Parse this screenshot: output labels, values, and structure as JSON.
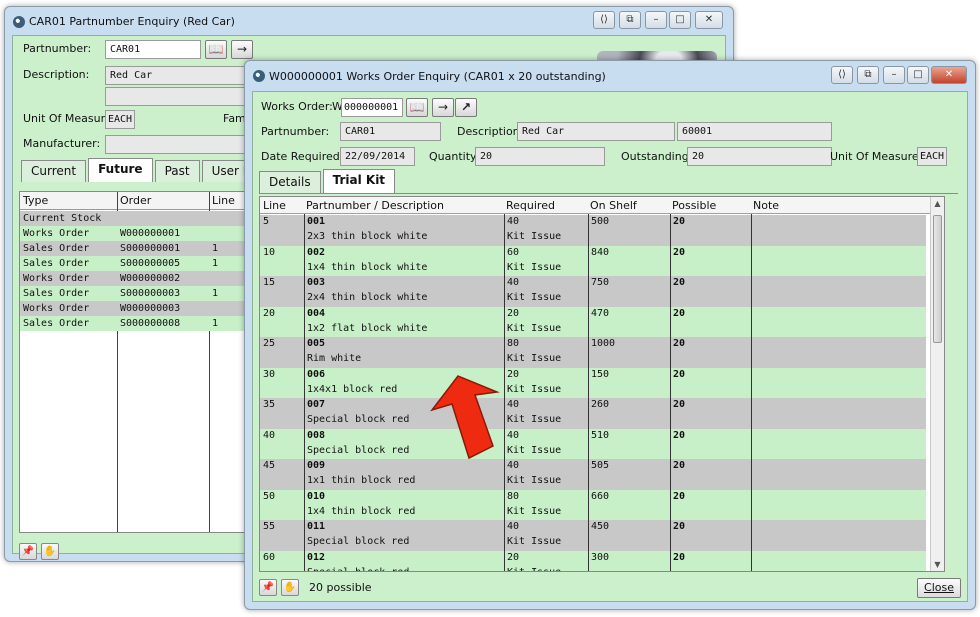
{
  "back_window": {
    "title": "CAR01 Partnumber Enquiry (Red Car)",
    "labels": {
      "partnumber": "Partnumber:",
      "description": "Description:",
      "unit_of_measure": "Unit Of Measure:",
      "family": "Famil",
      "manufacturer": "Manufacturer:"
    },
    "values": {
      "partnumber": "CAR01",
      "description": "Red Car",
      "unit_of_measure": "EACH"
    },
    "tabs": [
      "Current",
      "Future",
      "Past",
      "User Defined"
    ],
    "active_tab": "Future",
    "columns": [
      "Type",
      "Order",
      "Line"
    ],
    "rows": [
      {
        "type": "Current Stock",
        "order": "",
        "line": ""
      },
      {
        "type": "Works Order",
        "order": "W000000001",
        "line": ""
      },
      {
        "type": "Sales Order",
        "order": "S000000001",
        "line": "1"
      },
      {
        "type": "Sales Order",
        "order": "S000000005",
        "line": "1"
      },
      {
        "type": "Works Order",
        "order": "W000000002",
        "line": ""
      },
      {
        "type": "Sales Order",
        "order": "S000000003",
        "line": "1"
      },
      {
        "type": "Works Order",
        "order": "W000000003",
        "line": ""
      },
      {
        "type": "Sales Order",
        "order": "S000000008",
        "line": "1"
      }
    ]
  },
  "front_window": {
    "title": "W000000001 Works Order Enquiry (CAR01 x 20 outstanding)",
    "labels": {
      "works_order": "Works Order:",
      "partnumber": "Partnumber:",
      "description": "Description:",
      "date_required": "Date Required:",
      "quantity": "Quantity:",
      "outstanding": "Outstanding:",
      "unit_of_measure": "Unit Of Measure:"
    },
    "values": {
      "works_order_prefix": "W",
      "works_order": "000000001",
      "partnumber": "CAR01",
      "description": "Red Car",
      "extra_code": "60001",
      "date_required": "22/09/2014",
      "quantity": "20",
      "outstanding": "20",
      "unit_of_measure": "EACH"
    },
    "tabs": [
      "Details",
      "Trial Kit"
    ],
    "active_tab": "Trial Kit",
    "columns": [
      "Line",
      "Partnumber / Description",
      "Required",
      "On Shelf",
      "Possible",
      "Note"
    ],
    "rows": [
      {
        "line": "5",
        "part": "001",
        "desc": "2x3 thin block white",
        "required": "40",
        "issue": "Kit Issue",
        "on_shelf": "500",
        "possible": "20"
      },
      {
        "line": "10",
        "part": "002",
        "desc": "1x4 thin block white",
        "required": "60",
        "issue": "Kit Issue",
        "on_shelf": "840",
        "possible": "20"
      },
      {
        "line": "15",
        "part": "003",
        "desc": "2x4 thin block white",
        "required": "40",
        "issue": "Kit Issue",
        "on_shelf": "750",
        "possible": "20"
      },
      {
        "line": "20",
        "part": "004",
        "desc": "1x2 flat block white",
        "required": "20",
        "issue": "Kit Issue",
        "on_shelf": "470",
        "possible": "20"
      },
      {
        "line": "25",
        "part": "005",
        "desc": "Rim white",
        "required": "80",
        "issue": "Kit Issue",
        "on_shelf": "1000",
        "possible": "20"
      },
      {
        "line": "30",
        "part": "006",
        "desc": "1x4x1 block red",
        "required": "20",
        "issue": "Kit Issue",
        "on_shelf": "150",
        "possible": "20"
      },
      {
        "line": "35",
        "part": "007",
        "desc": "Special block red",
        "required": "40",
        "issue": "Kit Issue",
        "on_shelf": "260",
        "possible": "20"
      },
      {
        "line": "40",
        "part": "008",
        "desc": "Special block red",
        "required": "40",
        "issue": "Kit Issue",
        "on_shelf": "510",
        "possible": "20"
      },
      {
        "line": "45",
        "part": "009",
        "desc": "1x1 thin block red",
        "required": "40",
        "issue": "Kit Issue",
        "on_shelf": "505",
        "possible": "20"
      },
      {
        "line": "50",
        "part": "010",
        "desc": "1x4 thin block red",
        "required": "80",
        "issue": "Kit Issue",
        "on_shelf": "660",
        "possible": "20"
      },
      {
        "line": "55",
        "part": "011",
        "desc": "Special block red",
        "required": "40",
        "issue": "Kit Issue",
        "on_shelf": "450",
        "possible": "20"
      },
      {
        "line": "60",
        "part": "012",
        "desc": "Special block red",
        "required": "20",
        "issue": "Kit Issue",
        "on_shelf": "300",
        "possible": "20"
      }
    ],
    "status": "20 possible",
    "close_label": "Close"
  },
  "colors": {
    "window_frame": "#c9ddf0",
    "client_green": "#ccf0cc",
    "row_green": "#c8f0c8",
    "row_grey": "#c8c8c8",
    "arrow_red": "#ee2a10"
  }
}
